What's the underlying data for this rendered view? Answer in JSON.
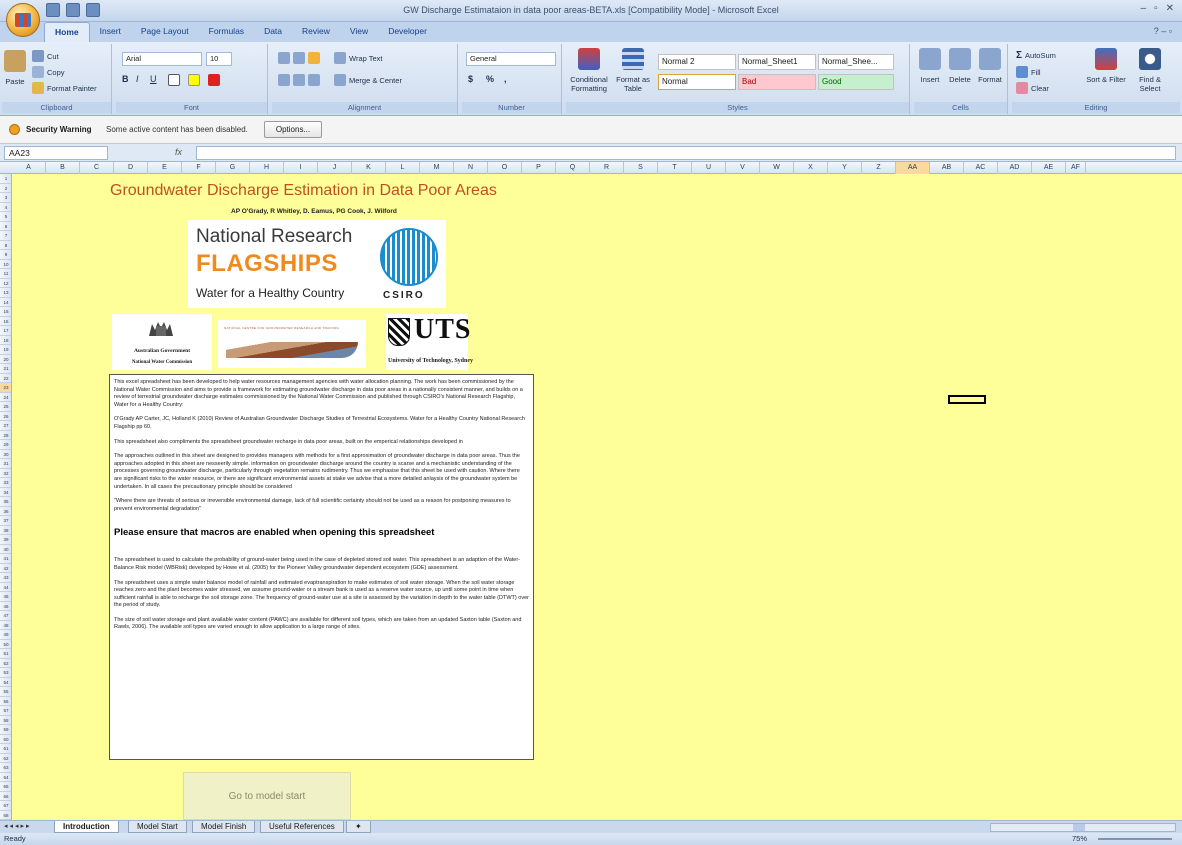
{
  "app": {
    "title": "GW Discharge Estimataion in data poor areas-BETA.xls  [Compatibility Mode] - Microsoft Excel",
    "window_controls": [
      "–",
      "▫",
      "✕"
    ],
    "help": "?  –  ▫"
  },
  "ribbon_tabs": [
    "Home",
    "Insert",
    "Page Layout",
    "Formulas",
    "Data",
    "Review",
    "View",
    "Developer"
  ],
  "ribbon": {
    "clipboard": {
      "label": "Clipboard",
      "paste": "Paste",
      "cut": "Cut",
      "copy": "Copy",
      "format_painter": "Format Painter"
    },
    "font": {
      "label": "Font",
      "name": "Arial",
      "size": "10",
      "bold": "B",
      "italic": "I",
      "underline": "U"
    },
    "alignment": {
      "label": "Alignment",
      "wrap_text": "Wrap Text",
      "merge_center": "Merge & Center"
    },
    "number": {
      "label": "Number",
      "format": "General",
      "currency": "$",
      "percent": "%",
      "comma": ","
    },
    "styles": {
      "label": "Styles",
      "conditional": "Conditional Formatting",
      "format_table": "Format as Table",
      "cells": [
        "Normal 2",
        "Normal_Sheet1",
        "Normal_Shee...",
        "Normal",
        "Bad",
        "Good"
      ]
    },
    "cells": {
      "label": "Cells",
      "insert": "Insert",
      "delete": "Delete",
      "format": "Format"
    },
    "editing": {
      "label": "Editing",
      "autosum": "AutoSum",
      "fill": "Fill",
      "clear": "Clear",
      "sort_filter": "Sort & Filter",
      "find_select": "Find & Select"
    }
  },
  "security": {
    "title": "Security Warning",
    "message": "Some active content has been disabled.",
    "options_button": "Options..."
  },
  "formula_bar": {
    "name_box": "AA23",
    "fx": "fx",
    "value": ""
  },
  "columns": [
    "A",
    "B",
    "C",
    "D",
    "E",
    "F",
    "G",
    "H",
    "I",
    "J",
    "K",
    "L",
    "M",
    "N",
    "O",
    "P",
    "Q",
    "R",
    "S",
    "T",
    "U",
    "V",
    "W",
    "X",
    "Y",
    "Z",
    "AA",
    "AB",
    "AC",
    "AD",
    "AE",
    "AF"
  ],
  "selected_column": "AA",
  "selected_row": 23,
  "row_count": 68,
  "sheet": {
    "title": "Groundwater Discharge Estimation in Data Poor Areas",
    "authors": "AP O'Grady, R Whitley, D. Eamus, PG Cook, J. Wilford",
    "logos": {
      "nrf_line1": "National Research",
      "nrf_line2": "FLAGSHIPS",
      "nrf_line3": "Water for a Healthy Country",
      "csiro": "CSIRO",
      "gov_line1": "Australian Government",
      "gov_line2": "National Water Commission",
      "ncg_text": "NATIONAL CENTRE FOR GROUNDWATER RESEARCH AND TRAINING",
      "uts_letters": "UTS",
      "uts_name": "University of Technology, Sydney"
    },
    "paragraphs": [
      "This excel spreadsheet has been developed to help water resources management agencies with water allocation planning. The work has been commissioned by the National Water Commission and aims to provide a framework for estimating groundwater discharge in data poor areas in a nationally consistent manner, and builds on a review of terrestrial groundwater discharge estimates commissioned by the National Water Commission and published through CSIRO's National Research Flagship, Water for a Healthy Country:",
      "O'Grady AP Carter, JC, Holland K (2010) Review of Australian Groundwater Discharge Studies of Terrestrial Ecosystems. Water for a Healthy Country National Research Flagship pp 60.",
      "This spreadsheet also compliments the spreadsheet groundwater recharge in data poor areas, built on the emperical relationships developed in",
      "The approaches outlined in this sheet are designed to provides managers with methods for a first approximation of groundwater discharge in data poor areas. Thus the approaches adopted in this sheet are nesseerily simple. information on groundwater discharge around the country is scarse and a mechanistic understanding of the processes governing groundwater discharge, particularly through vegetation remains rudimentry. Thus we emphasise that this sheet be used with caution.  Where there are significant risks to the water resource, or there are significant environmental assets at stake we advise that a more detailed anlaysis of the groundwater system be undertaken. In all cases the precautionary principle should be considered",
      "\"Where there are threats of serious or irreversible environmental damage, lack of full scientific certainty should not be used as a reason for postponing measures to prevent environmental degradation\""
    ],
    "macro_notice": "Please ensure that macros are enabled when opening this spreadsheet",
    "paragraphs2": [
      "The spreadsheet is used to calculate the probability of ground-water being used in the case of depleted stored soil water. This spreadsheet is an adaption of the Water-Balance Risk model (WBRisk) developed by Howe et al. (2005) for the Pioneer Valley groundwater dependent ecosystem (GDE) assessment.",
      "The spreadsheet uses a simple water balance model of rainfall and estimated evaptranspiration to make estimates of soil water storage. When the soil water storage reaches zero and the plant becomes water stressed, we assume ground-water or a stream bank is used as a reserve water source, up until some point in time when sufficient rainfall is able to recharge the soil storage zone. The frequency of ground-water use at a site is assessed by the variation in depth to the water table (DTWT) over the period of study.",
      "The size of soil water storage and plant available water content (PAWC) are available for different soil types, which are taken from an updated Saxton table (Saxton and Rawls, 2006). The available soil types are varied enough to allow application to a large range of sites."
    ],
    "go_button": "Go to model start"
  },
  "sheet_tabs": [
    "Introduction",
    "Model Start",
    "Model Finish",
    "Useful References"
  ],
  "active_sheet_tab": "Introduction",
  "status": {
    "text": "Ready",
    "zoom": "75%"
  }
}
